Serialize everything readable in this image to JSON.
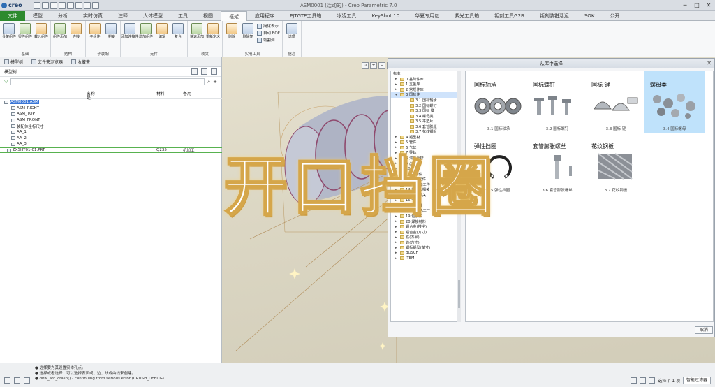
{
  "window": {
    "title": "ASM0001 (活动的) - Creo Parametric 7.0",
    "logo": "creo"
  },
  "tabs": [
    "文件",
    "模型",
    "分析",
    "实时仿真",
    "注释",
    "人体模型",
    "工具",
    "视图",
    "框架",
    "应用程序",
    "PJTGTE工具箱",
    "冰凌工具",
    "KeyShot 10",
    "华夏专用包",
    "紫光工具箱",
    "钜刻工具G2B",
    "钜刻装钳活运",
    "SOK",
    "公开"
  ],
  "ribbon": {
    "groups": [
      {
        "name": "基础",
        "buttons": [
          "骨架组件",
          "零件组件",
          "载入组件"
        ]
      },
      {
        "name": "结构",
        "buttons": [
          "组件添加",
          "连接"
        ]
      },
      {
        "name": "子装配",
        "buttons": [
          "子组件",
          "拼接"
        ]
      },
      {
        "name": "元件",
        "buttons": [
          "添加连接件",
          "增加组件",
          "编辑",
          "复合"
        ]
      },
      {
        "name": "装夹",
        "buttons": [
          "快速添加",
          "重新定义"
        ]
      },
      {
        "name": "实用工具",
        "buttons": [
          "删除",
          "删除复"
        ],
        "small": [
          "简化表示",
          "自动 BOF",
          "切割列"
        ]
      },
      {
        "name": "信息",
        "buttons": [
          "选项"
        ]
      }
    ]
  },
  "left_panel": {
    "nav_tabs": [
      "模型树",
      "文件夹浏览器",
      "收藏夹"
    ],
    "tree_title": "模型树",
    "columns": [
      "名称",
      "类型",
      "材料",
      "备用"
    ],
    "rows": [
      {
        "name": "ASM0001.ASM",
        "c1": "",
        "c2": ""
      },
      {
        "name": "ASM_RIGHT",
        "c1": "",
        "c2": ""
      },
      {
        "name": "ASM_TOP",
        "c1": "",
        "c2": ""
      },
      {
        "name": "ASM_FRONT",
        "c1": "",
        "c2": ""
      },
      {
        "name": "装配体坐标尺寸",
        "c1": "",
        "c2": ""
      },
      {
        "name": "AA_1",
        "c1": "",
        "c2": ""
      },
      {
        "name": "AA_2",
        "c1": "",
        "c2": ""
      },
      {
        "name": "AA_3",
        "c1": "",
        "c2": ""
      },
      {
        "name": "ZXSHT01-01.PRT",
        "c1": "Q235",
        "c2": "机加工"
      }
    ],
    "first_row_type": "是"
  },
  "dialog": {
    "title": "从库中选择",
    "close": "✕",
    "tree_root": "标准",
    "tree": [
      "0 基础件库",
      "1 五金库",
      "2 常规件库",
      "3 国标件",
      "3.1 国标轴承",
      "3.2 国标螺钉",
      "3.3 国标 键",
      "3.4 螺母类",
      "3.5 平垫片",
      "3.6 套管膨胀",
      "3.7 花纹钢板",
      "4 铝型材",
      "5 管件",
      "6 气缸",
      "7 导轨",
      "8 滚珠丝杆",
      "9 齿轮",
      "10 链条",
      "11 机构件",
      "12 气动元件",
      "13 CNC加工件",
      "14 机器人相关",
      "15 传感相关",
      "16 气阀",
      "17 减速机",
      "18 品牌FA工厂",
      "19 包装件",
      "20 焊接材料",
      "铝合金(带半)",
      "铝合金(方寸)",
      "铁(方半)",
      "铁(方寸)",
      "钢板铝型(单寸)",
      "BOSCH",
      "ITEM"
    ],
    "items": [
      {
        "title": "国标轴承",
        "caption": "3.1 国标轴承"
      },
      {
        "title": "国标螺钉",
        "caption": "3.2 国标螺钉"
      },
      {
        "title": "国标 键",
        "caption": "3.3 国标 键"
      },
      {
        "title": "螺母类",
        "caption": "3.4 国标螺母"
      },
      {
        "title": "弹性挡圈",
        "caption": "3.5 弹性挡圈"
      },
      {
        "title": "套管膨胀螺丝",
        "caption": "3.6 套管膨胀螺丝"
      },
      {
        "title": "花纹钢板",
        "caption": "3.7 花纹钢板"
      }
    ],
    "cancel": "取消"
  },
  "caption": "开口挡圈",
  "status": {
    "messages": [
      "● 选择要为其设置实体孔点。",
      "● 选择或者选择：可以选择表面或、边、线或曲线来创建。",
      "● dbw_arc_crash() - continuing from serious error (CRUSH_DEBUG)."
    ],
    "selected": "选择了 1 项",
    "filter": "智能过滤器"
  },
  "colors": {
    "accent": "#2d8a2e",
    "selection": "#bfe2fb"
  }
}
